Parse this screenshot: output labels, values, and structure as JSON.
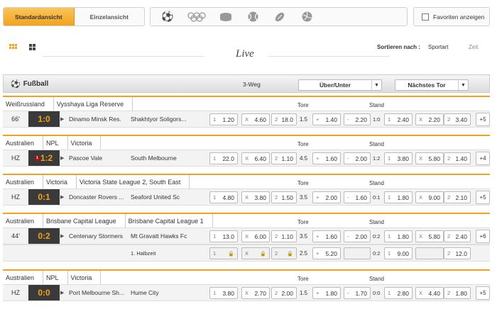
{
  "views": {
    "standard": "Standardansicht",
    "single": "Einzelansicht"
  },
  "sports_icons": [
    "soccer-ball-icon",
    "olympics-rings-icon",
    "hockey-puck-icon",
    "tennis-ball-icon",
    "football-icon",
    "volleyball-icon"
  ],
  "favorites_label": "Favoriten anzeigen",
  "live_label": "Live",
  "sort": {
    "label": "Sortieren nach :",
    "option1": "Sportart",
    "option2": "Zeit"
  },
  "section": {
    "title": "Fußball",
    "market": "3-Weg",
    "dropdown1": "Über/Unter",
    "dropdown2": "Nächstes Tor"
  },
  "col": {
    "goals": "Tore",
    "state": "Stand"
  },
  "matches": [
    {
      "crumbs": [
        "Weißrussland",
        "Vysshaya Liga Reserve"
      ],
      "min": "66'",
      "score": "1:0",
      "red": "",
      "home": "Dinamo Minsk Res.",
      "away": "Shakhtyor Soligors...",
      "o1": "1.20",
      "oX": "4.60",
      "o2": "18.0",
      "line": "1.5",
      "plus": "1.40",
      "minus": "2.20",
      "stand": "1:0",
      "n1": "2.40",
      "nX": "2.20",
      "n2": "3.40",
      "more": "+5"
    },
    {
      "crumbs": [
        "Australien",
        "NPL",
        "Victoria"
      ],
      "min": "HZ",
      "score": "1:2",
      "red": "1",
      "home": "Pascoe Vale",
      "away": "South Melbourne",
      "o1": "22.0",
      "oX": "6.40",
      "o2": "1.10",
      "line": "4.5",
      "plus": "1.60",
      "minus": "2.00",
      "stand": "1:2",
      "n1": "3.80",
      "nX": "5.80",
      "n2": "1.40",
      "more": "+4"
    },
    {
      "crumbs": [
        "Australien",
        "Victoria",
        "Victoria State League 2, South East"
      ],
      "min": "HZ",
      "score": "0:1",
      "red": "",
      "home": "Doncaster Rovers ...",
      "away": "Seaford United Sc",
      "o1": "4.80",
      "oX": "3.80",
      "o2": "1.50",
      "line": "3.5",
      "plus": "2.00",
      "minus": "1.60",
      "stand": "0:1",
      "n1": "1.80",
      "nX": "9.00",
      "n2": "2.10",
      "more": "+5"
    },
    {
      "crumbs": [
        "Australien",
        "Brisbane Capital League",
        "Brisbane Capital League 1"
      ],
      "min": "44'",
      "score": "0:2",
      "red": "",
      "home": "Centenary Stormers",
      "away": "Mt Gravatt Hawks Fc",
      "o1": "13.0",
      "oX": "6.00",
      "o2": "1.10",
      "line": "3.5",
      "plus": "1.60",
      "minus": "2.00",
      "stand": "0:2",
      "n1": "1.80",
      "nX": "5.80",
      "n2": "2.40",
      "more": "+6",
      "sub": {
        "label": "1. Halbzeit",
        "line": "2.5",
        "plus": "5.20",
        "stand": "0:2",
        "n1": "9.00",
        "n2": "12.0"
      }
    },
    {
      "crumbs": [
        "Australien",
        "NPL",
        "Victoria"
      ],
      "min": "HZ",
      "score": "0:0",
      "red": "",
      "home": "Port Melbourne Sh...",
      "away": "Hume City",
      "o1": "3.80",
      "oX": "2.70",
      "o2": "2.00",
      "line": "1.5",
      "plus": "1.80",
      "minus": "1.70",
      "stand": "0:0",
      "n1": "2.80",
      "nX": "4.40",
      "n2": "1.80",
      "more": "+5"
    }
  ],
  "keys": {
    "one": "1",
    "x": "X",
    "two": "2",
    "plus": "+",
    "minus": "-"
  }
}
